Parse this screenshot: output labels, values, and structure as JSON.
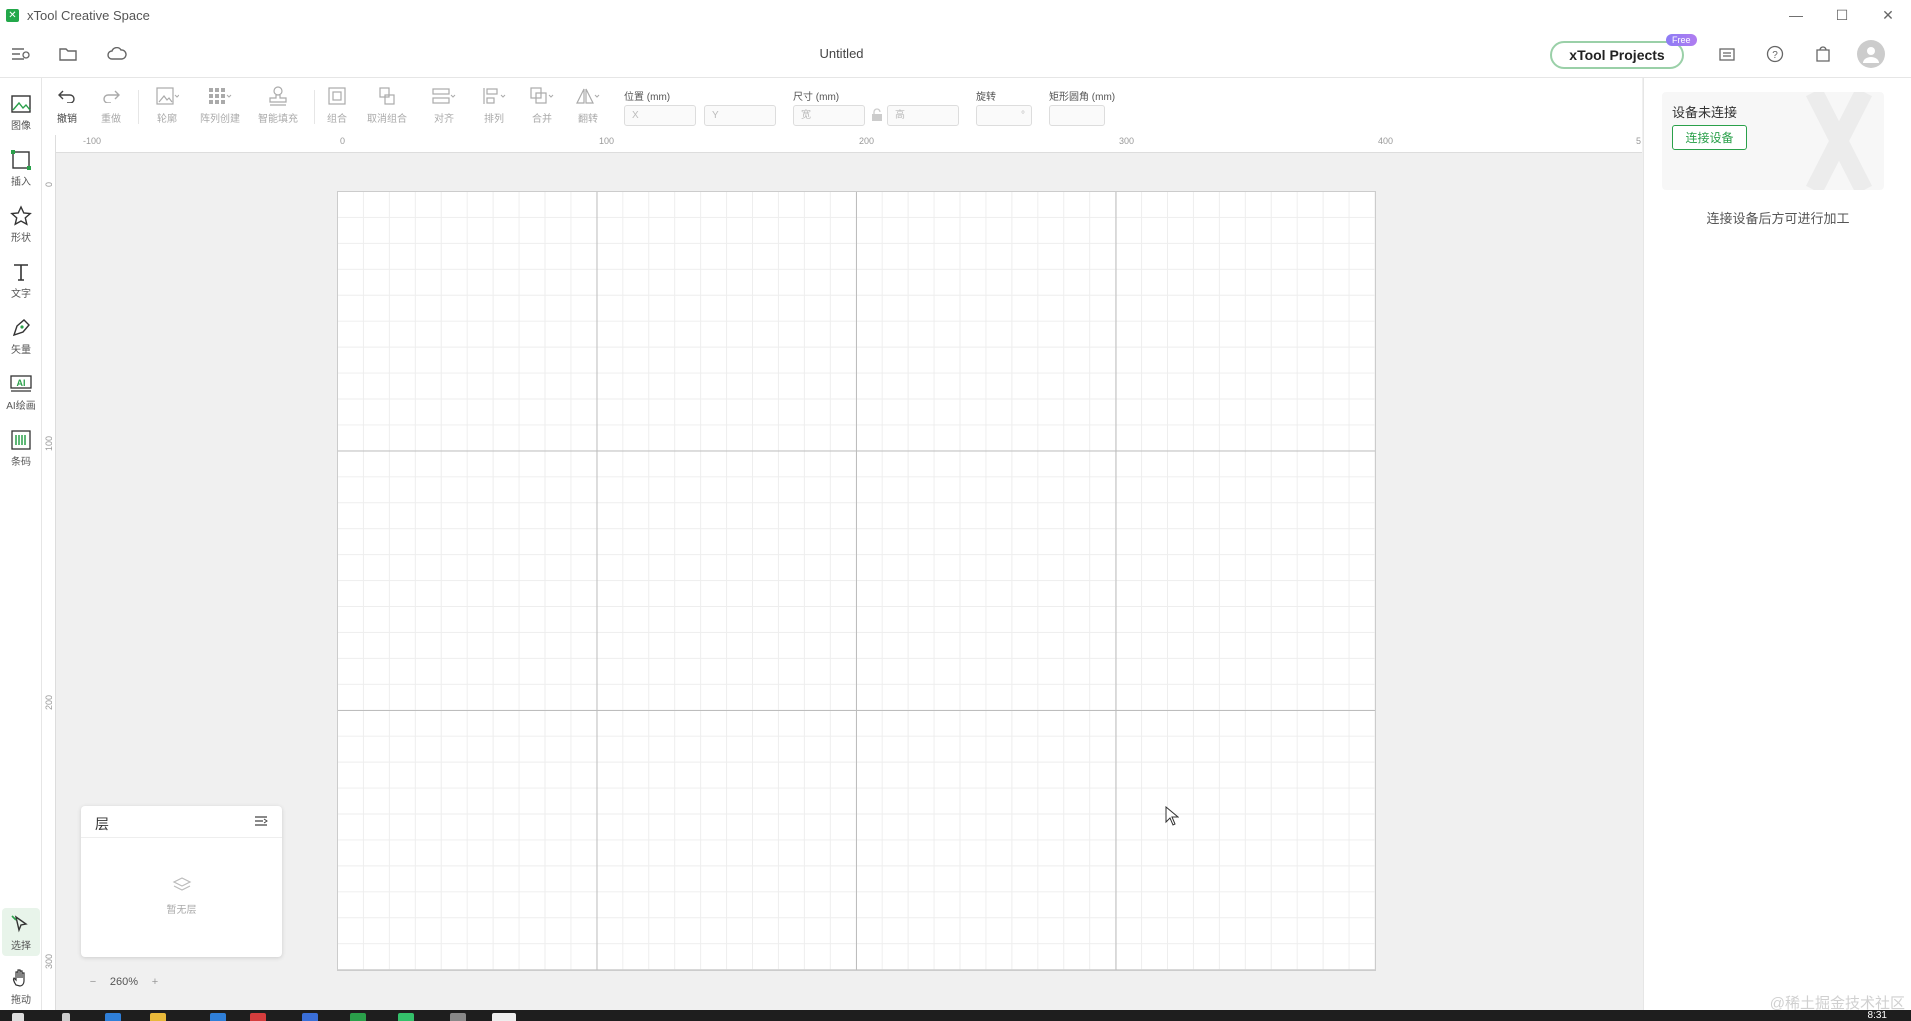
{
  "window": {
    "app_title": "xTool Creative Space",
    "logo_icon": "xtool-logo-icon"
  },
  "header": {
    "doc_title": "Untitled",
    "projects_label": "xTool Projects",
    "free_badge": "Free",
    "accent": "#2aa04a"
  },
  "left_tools": [
    {
      "label": "图像",
      "icon": "image-icon"
    },
    {
      "label": "插入",
      "icon": "insert-icon"
    },
    {
      "label": "形状",
      "icon": "shape-icon"
    },
    {
      "label": "文字",
      "icon": "text-icon"
    },
    {
      "label": "矢量",
      "icon": "pen-icon"
    },
    {
      "label": "AI绘画",
      "icon": "ai-icon"
    },
    {
      "label": "条码",
      "icon": "barcode-icon"
    },
    {
      "label": "选择",
      "icon": "select-icon"
    },
    {
      "label": "拖动",
      "icon": "hand-icon"
    }
  ],
  "toolbar": {
    "undo": "撤销",
    "redo": "重做",
    "outline": "轮廓",
    "array": "阵列创建",
    "smart_fill": "智能填充",
    "group": "组合",
    "ungroup": "取消组合",
    "align": "对齐",
    "arrange": "排列",
    "combine": "合并",
    "flip": "翻转",
    "position_label": "位置 (mm)",
    "x_placeholder": "X",
    "y_placeholder": "Y",
    "size_label": "尺寸 (mm)",
    "width_placeholder": "宽",
    "height_placeholder": "高",
    "rotate_label": "旋转",
    "rotate_unit": "°",
    "corner_label": "矩形圆角 (mm)"
  },
  "ruler": {
    "top": [
      "-100",
      "0",
      "100",
      "200",
      "300",
      "400",
      "5"
    ],
    "left": [
      "0",
      "100",
      "200",
      "300"
    ]
  },
  "layers": {
    "title": "层",
    "empty": "暂无层"
  },
  "zoom": {
    "minus": "−",
    "value": "260%",
    "plus": "+"
  },
  "device": {
    "status": "设备未连接",
    "connect_label": "连接设备",
    "hint": "连接设备后方可进行加工"
  },
  "taskbar": {
    "clock": "8:31"
  },
  "watermark": "@稀土掘金技术社区"
}
